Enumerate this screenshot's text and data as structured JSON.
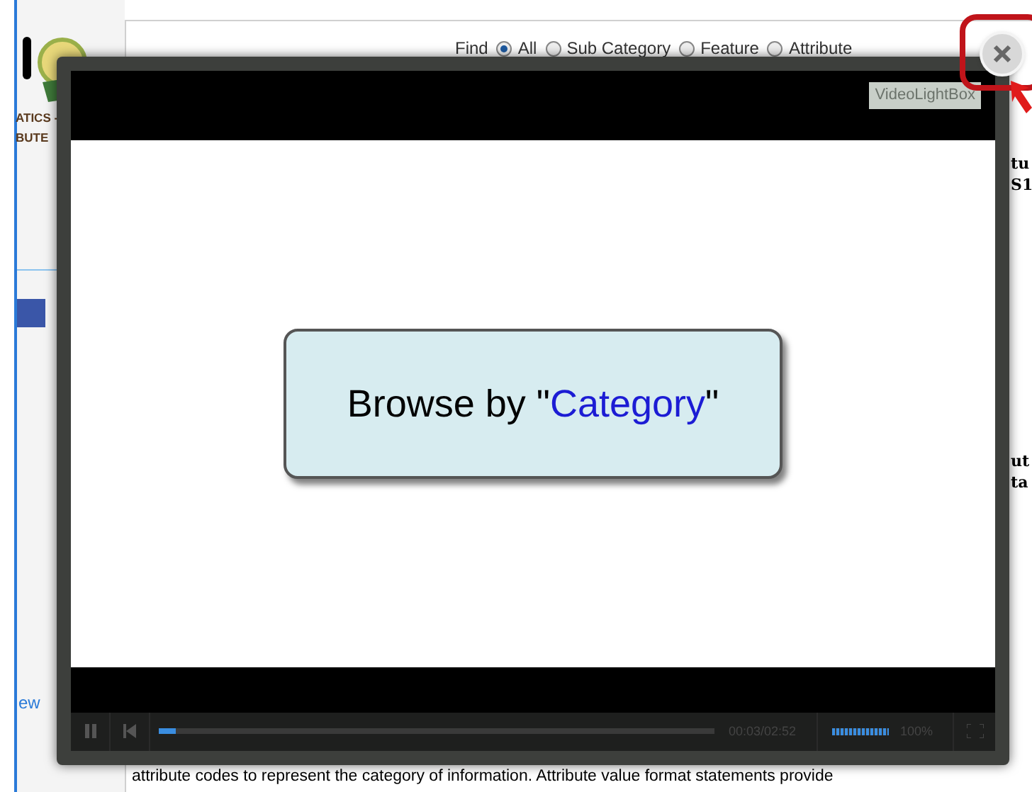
{
  "sidebar": {
    "logo_lines": [
      "ATICS -",
      "BUTE"
    ],
    "link": "ew"
  },
  "find": {
    "label": "Find",
    "options": [
      {
        "label": "All",
        "selected": true
      },
      {
        "label": "Sub Category",
        "selected": false
      },
      {
        "label": "Feature",
        "selected": false
      },
      {
        "label": "Attribute",
        "selected": false
      }
    ]
  },
  "right_fragments": [
    {
      "lines": [
        "tu",
        "S1"
      ]
    },
    {
      "lines": [
        "ut",
        "ta"
      ]
    }
  ],
  "body_text": "attribute codes to represent the category of information. Attribute value format statements provide",
  "lightbox": {
    "badge": "VideoLightBox",
    "slide": {
      "parts": [
        {
          "text": "Browse by \"",
          "highlight": false
        },
        {
          "text": "Category",
          "highlight": true
        },
        {
          "text": "\"",
          "highlight": false
        }
      ]
    },
    "controls": {
      "playing": true,
      "progress": {
        "level": 0.03
      },
      "time": "00:03/02:52",
      "volume": {
        "level": 1
      },
      "volume_text": "100%"
    }
  }
}
